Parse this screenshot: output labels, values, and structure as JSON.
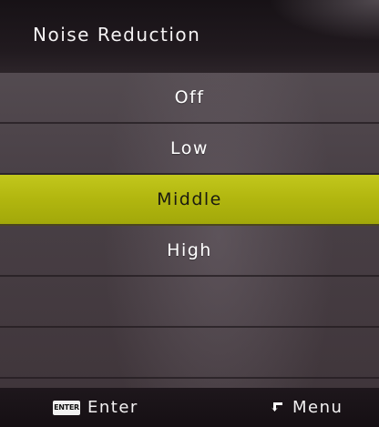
{
  "header": {
    "title": "Noise Reduction"
  },
  "options": [
    {
      "label": "Off",
      "selected": false
    },
    {
      "label": "Low",
      "selected": false
    },
    {
      "label": "Middle",
      "selected": true
    },
    {
      "label": "High",
      "selected": false
    },
    {
      "label": "",
      "selected": false
    },
    {
      "label": "",
      "selected": false
    }
  ],
  "footer": {
    "enter_icon_text": "ENTER",
    "enter_label": "Enter",
    "menu_label": "Menu",
    "enter_icon": "enter-key-icon",
    "menu_icon": "return-arrow-icon"
  },
  "colors": {
    "highlight": "#b5ba12",
    "background": "#4a4147",
    "bar": "#1c161a"
  }
}
